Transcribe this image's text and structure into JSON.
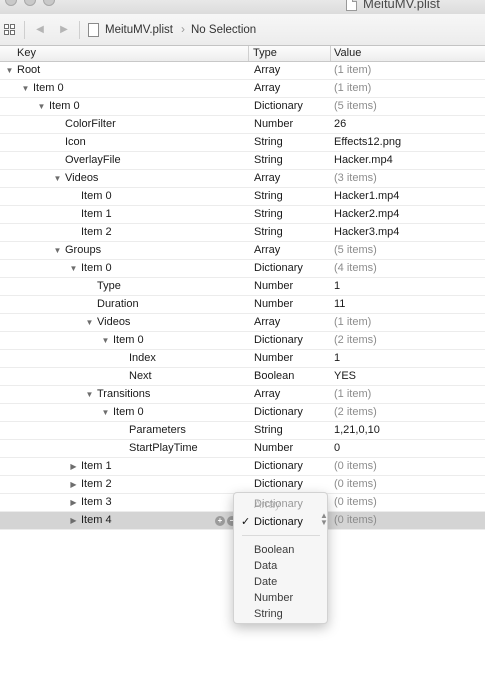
{
  "window": {
    "title": "MeituMV.plist"
  },
  "jumpbar": {
    "file": "MeituMV.plist",
    "selection": "No Selection"
  },
  "header": {
    "key": "Key",
    "type": "Type",
    "value": "Value"
  },
  "rows": [
    {
      "key": "Root",
      "type": "Array",
      "value": "(1 item)",
      "depth": 0,
      "disclosure": "open",
      "summary": true
    },
    {
      "key": "Item 0",
      "type": "Array",
      "value": "(1 item)",
      "depth": 1,
      "disclosure": "open",
      "summary": true
    },
    {
      "key": "Item 0",
      "type": "Dictionary",
      "value": "(5 items)",
      "depth": 2,
      "disclosure": "open",
      "summary": true
    },
    {
      "key": "ColorFilter",
      "type": "Number",
      "value": "26",
      "depth": 3,
      "disclosure": "none",
      "summary": false
    },
    {
      "key": "Icon",
      "type": "String",
      "value": "Effects12.png",
      "depth": 3,
      "disclosure": "none",
      "summary": false
    },
    {
      "key": "OverlayFile",
      "type": "String",
      "value": "Hacker.mp4",
      "depth": 3,
      "disclosure": "none",
      "summary": false
    },
    {
      "key": "Videos",
      "type": "Array",
      "value": "(3 items)",
      "depth": 3,
      "disclosure": "open",
      "summary": true
    },
    {
      "key": "Item 0",
      "type": "String",
      "value": "Hacker1.mp4",
      "depth": 4,
      "disclosure": "none",
      "summary": false
    },
    {
      "key": "Item 1",
      "type": "String",
      "value": "Hacker2.mp4",
      "depth": 4,
      "disclosure": "none",
      "summary": false
    },
    {
      "key": "Item 2",
      "type": "String",
      "value": "Hacker3.mp4",
      "depth": 4,
      "disclosure": "none",
      "summary": false
    },
    {
      "key": "Groups",
      "type": "Array",
      "value": "(5 items)",
      "depth": 3,
      "disclosure": "open",
      "summary": true
    },
    {
      "key": "Item 0",
      "type": "Dictionary",
      "value": "(4 items)",
      "depth": 4,
      "disclosure": "open",
      "summary": true
    },
    {
      "key": "Type",
      "type": "Number",
      "value": "1",
      "depth": 5,
      "disclosure": "none",
      "summary": false
    },
    {
      "key": "Duration",
      "type": "Number",
      "value": "11",
      "depth": 5,
      "disclosure": "none",
      "summary": false
    },
    {
      "key": "Videos",
      "type": "Array",
      "value": "(1 item)",
      "depth": 5,
      "disclosure": "open",
      "summary": true
    },
    {
      "key": "Item 0",
      "type": "Dictionary",
      "value": "(2 items)",
      "depth": 6,
      "disclosure": "open",
      "summary": true
    },
    {
      "key": "Index",
      "type": "Number",
      "value": "1",
      "depth": 7,
      "disclosure": "none",
      "summary": false
    },
    {
      "key": "Next",
      "type": "Boolean",
      "value": "YES",
      "depth": 7,
      "disclosure": "none",
      "summary": false
    },
    {
      "key": "Transitions",
      "type": "Array",
      "value": "(1 item)",
      "depth": 5,
      "disclosure": "open",
      "summary": true
    },
    {
      "key": "Item 0",
      "type": "Dictionary",
      "value": "(2 items)",
      "depth": 6,
      "disclosure": "open",
      "summary": true
    },
    {
      "key": "Parameters",
      "type": "String",
      "value": "1,21,0,10",
      "depth": 7,
      "disclosure": "none",
      "summary": false
    },
    {
      "key": "StartPlayTime",
      "type": "Number",
      "value": "0",
      "depth": 7,
      "disclosure": "none",
      "summary": false
    },
    {
      "key": "Item 1",
      "type": "Dictionary",
      "value": "(0 items)",
      "depth": 4,
      "disclosure": "closed",
      "summary": true
    },
    {
      "key": "Item 2",
      "type": "Dictionary",
      "value": "(0 items)",
      "depth": 4,
      "disclosure": "closed",
      "summary": true
    },
    {
      "key": "Item 3",
      "type": "Dictionary",
      "value": "(0 items)",
      "depth": 4,
      "disclosure": "closed",
      "summary": true
    },
    {
      "key": "Item 4",
      "type": "Dictionary",
      "value": "(0 items)",
      "depth": 4,
      "disclosure": "closed",
      "summary": true,
      "selected": true
    }
  ],
  "type_menu": {
    "top_items": [
      "Dictionary",
      "Array"
    ],
    "current": "Dictionary",
    "items": [
      "Boolean",
      "Data",
      "Date",
      "Number",
      "String"
    ]
  },
  "icons": {
    "grid": "grid-icon",
    "back": "back-arrow-icon",
    "forward": "forward-arrow-icon",
    "add": "add-row-icon",
    "remove": "remove-row-icon",
    "check": "checkmark-icon",
    "file": "plist-file-icon"
  },
  "colors": {
    "selected_row": "#d4d4d4",
    "summary_text": "#8c8c8c"
  }
}
